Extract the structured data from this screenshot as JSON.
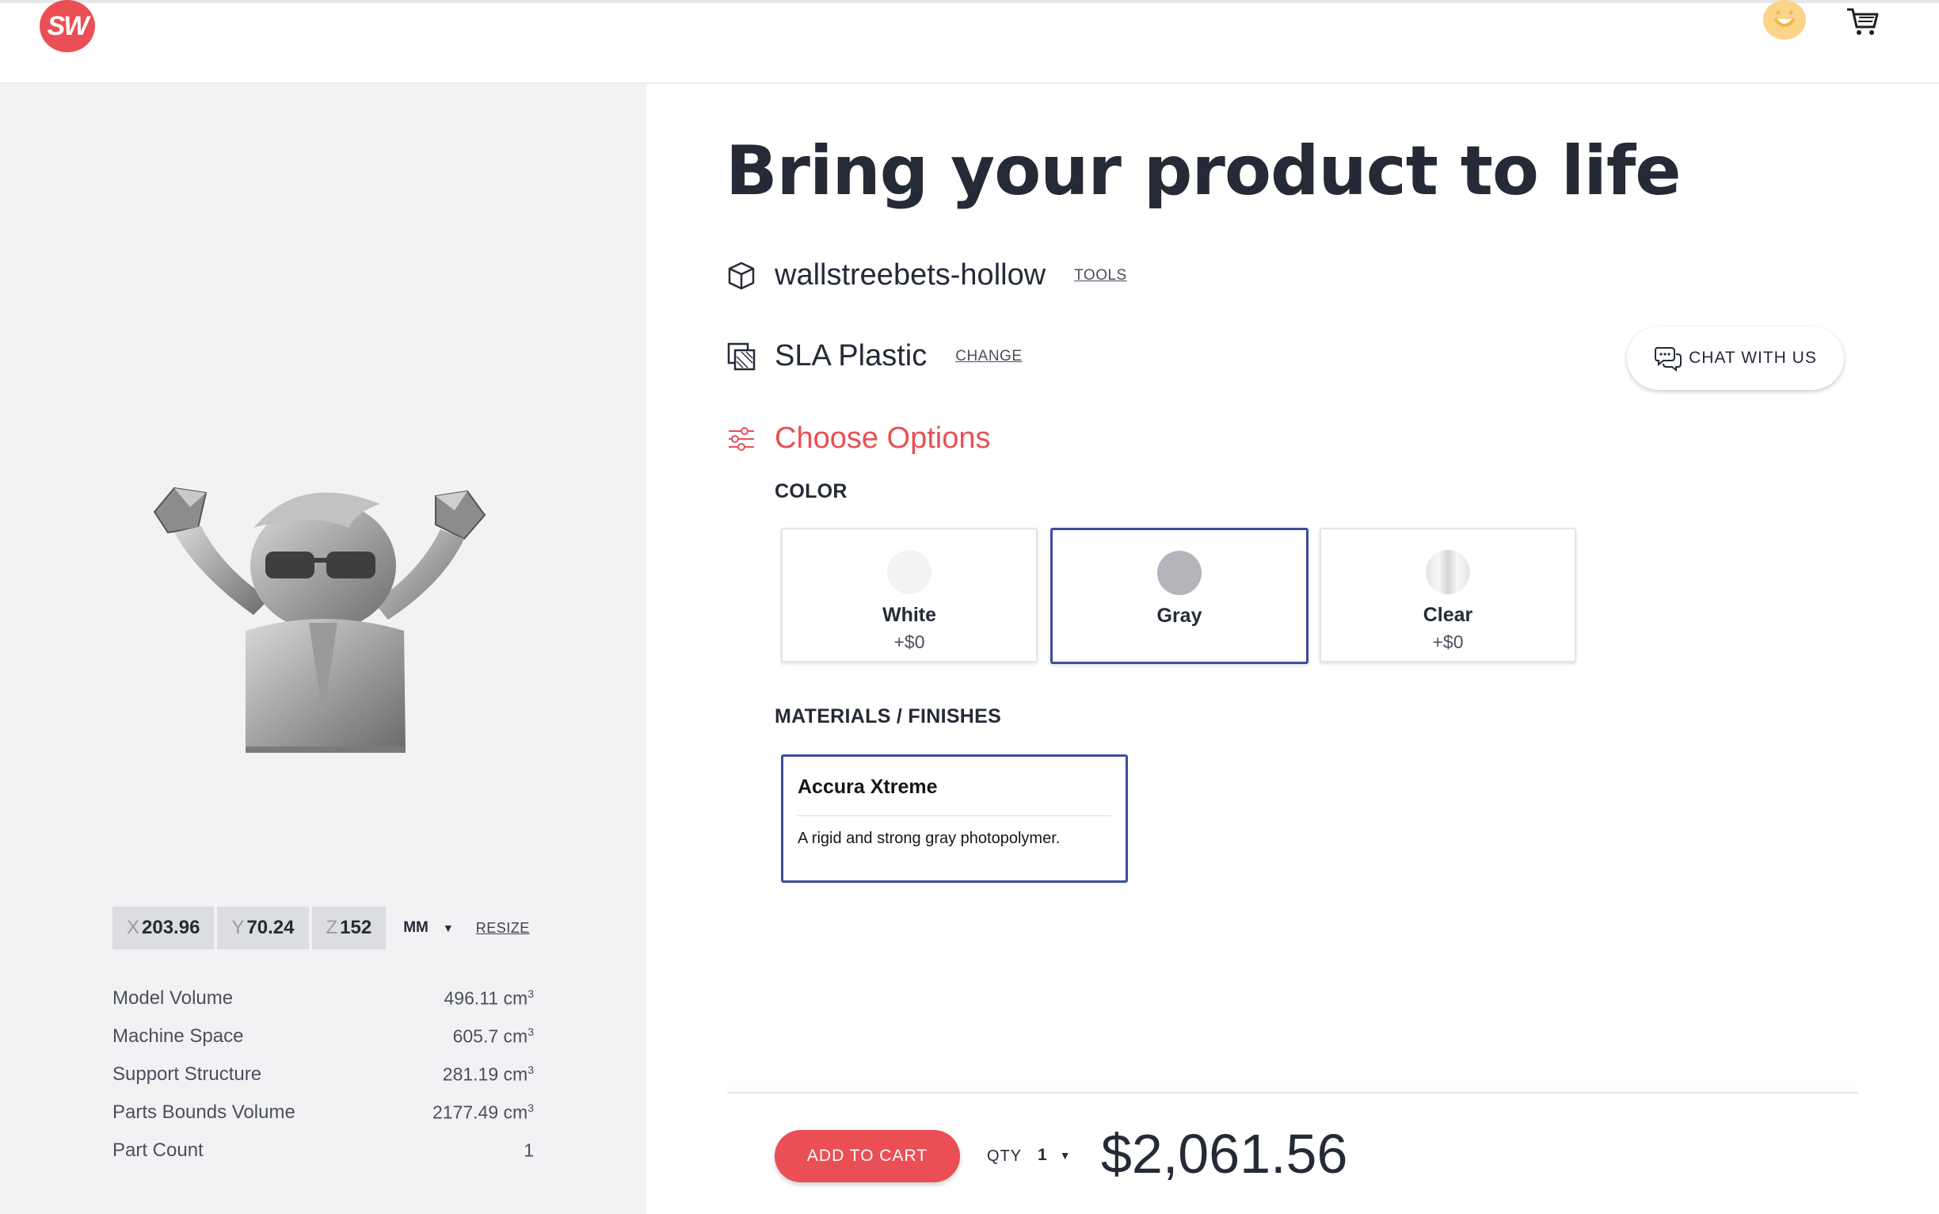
{
  "header": {
    "logo_text": "SW",
    "avatar_icon": "smiley-avatar-icon",
    "cart_icon": "shopping-cart-icon"
  },
  "model_panel": {
    "dimensions": {
      "x_label": "X",
      "x_value": "203.96",
      "y_label": "Y",
      "y_value": "70.24",
      "z_label": "Z",
      "z_value": "152",
      "units": "MM",
      "resize_label": "RESIZE"
    },
    "stats": [
      {
        "label": "Model Volume",
        "value": "496.11 cm",
        "unit_sup": "3"
      },
      {
        "label": "Machine Space",
        "value": "605.7 cm",
        "unit_sup": "3"
      },
      {
        "label": "Support Structure",
        "value": "281.19 cm",
        "unit_sup": "3"
      },
      {
        "label": "Parts Bounds Volume",
        "value": "2177.49 cm",
        "unit_sup": "3"
      },
      {
        "label": "Part Count",
        "value": "1",
        "unit_sup": ""
      }
    ]
  },
  "main": {
    "title": "Bring your product to life",
    "file": {
      "name": "wallstreebets-hollow",
      "link": "TOOLS",
      "icon": "cube-icon"
    },
    "material": {
      "name": "SLA Plastic",
      "link": "CHANGE",
      "icon": "material-icon"
    },
    "options": {
      "label": "Choose Options",
      "icon": "sliders-icon"
    },
    "chat_label": "CHAT WITH US",
    "color_label": "COLOR",
    "colors": [
      {
        "label": "White",
        "price": "+$0",
        "swatch": "#f4f3f1",
        "selected": false
      },
      {
        "label": "Gray",
        "price": "",
        "swatch": "#b4b5ba",
        "selected": true
      },
      {
        "label": "Clear",
        "price": "+$0",
        "swatch": "#e6e6e9",
        "selected": false
      }
    ],
    "finishes_label": "MATERIALS / FINISHES",
    "finish": {
      "name": "Accura Xtreme",
      "description": "A rigid and strong gray photopolymer."
    }
  },
  "footer": {
    "add_to_cart": "ADD TO CART",
    "qty_label": "QTY",
    "qty_value": "1",
    "total": "$2,061.56"
  },
  "colors": {
    "accent": "#ea4f55",
    "selected_border": "#3d4d9c",
    "text": "#252a37"
  }
}
